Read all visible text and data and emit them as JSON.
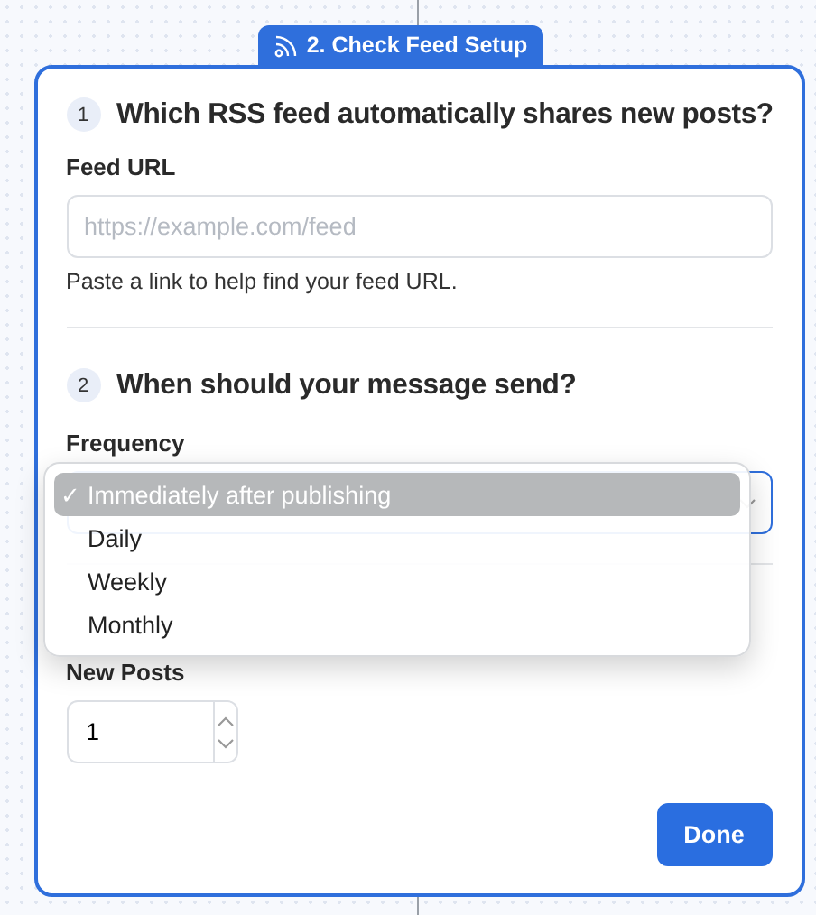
{
  "step_tab": {
    "label": "2. Check Feed Setup"
  },
  "sections": [
    {
      "number": "1",
      "heading": "Which RSS feed automatically shares new posts?"
    },
    {
      "number": "2",
      "heading": "When should your message send?"
    }
  ],
  "feed_url": {
    "label": "Feed URL",
    "placeholder": "https://example.com/feed",
    "help": "Paste a link to help find your feed URL."
  },
  "frequency": {
    "label": "Frequency",
    "check_mark": "✓",
    "menu": [
      {
        "label": "Immediately after publishing",
        "selected": true
      },
      {
        "label": "Daily",
        "selected": false
      },
      {
        "label": "Weekly",
        "selected": false
      },
      {
        "label": "Monthly",
        "selected": false
      }
    ]
  },
  "new_posts": {
    "label": "New Posts",
    "value": "1"
  },
  "done_button": "Done"
}
